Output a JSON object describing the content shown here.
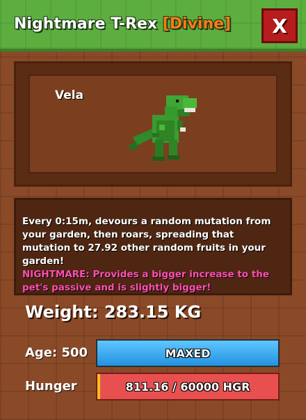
{
  "header": {
    "title": "Nightmare T-Rex",
    "rarity": "[Divine]",
    "close_label": "X"
  },
  "pet": {
    "variant": "Vela",
    "description": "Every 0:15m, devours a random mutation from your garden, then roars, spreading that mutation to 27.92 other random fruits in your garden!",
    "mutation_name": "NIGHTMARE:",
    "mutation_text": "Provides a bigger increase to the pet's passive and is slightly bigger!"
  },
  "stats": {
    "weight": "Weight: 283.15 KG",
    "age_label": "Age: 500",
    "age_value": "MAXED",
    "hunger_label": "Hunger",
    "hunger_value": "811.16 / 60000 HGR",
    "hunger_fraction": 0.0135
  },
  "colors": {
    "header_green": "#5cae3f",
    "rarity_orange": "#ff7a1a",
    "mutation_pink": "#ff4fb2",
    "age_bar_blue": "#2393e0",
    "hunger_bar_red": "#e85050"
  }
}
